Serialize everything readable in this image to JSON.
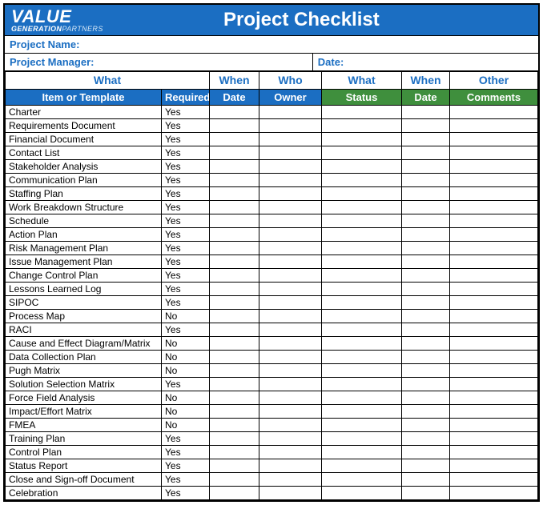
{
  "brand": {
    "name_top": "VALUE",
    "name_sub_bold": "GENERATION",
    "name_sub_light": "PARTNERS"
  },
  "title": "Project Checklist",
  "info": {
    "project_name_label": "Project Name:",
    "project_manager_label": "Project Manager:",
    "date_label": "Date:"
  },
  "group_headers": {
    "what": "What",
    "when": "When",
    "who": "Who",
    "what2": "What",
    "when2": "When",
    "other": "Other"
  },
  "col_headers": {
    "item": "Item or Template",
    "required": "Required",
    "date": "Date",
    "owner": "Owner",
    "status": "Status",
    "date2": "Date",
    "comments": "Comments"
  },
  "rows": [
    {
      "item": "Charter",
      "required": "Yes"
    },
    {
      "item": "Requirements Document",
      "required": "Yes"
    },
    {
      "item": "Financial Document",
      "required": "Yes"
    },
    {
      "item": "Contact List",
      "required": "Yes"
    },
    {
      "item": "Stakeholder Analysis",
      "required": "Yes"
    },
    {
      "item": "Communication Plan",
      "required": "Yes"
    },
    {
      "item": "Staffing Plan",
      "required": "Yes"
    },
    {
      "item": "Work Breakdown Structure",
      "required": "Yes"
    },
    {
      "item": "Schedule",
      "required": "Yes"
    },
    {
      "item": "Action Plan",
      "required": "Yes"
    },
    {
      "item": "Risk Management Plan",
      "required": "Yes"
    },
    {
      "item": "Issue Management Plan",
      "required": "Yes"
    },
    {
      "item": "Change Control Plan",
      "required": "Yes"
    },
    {
      "item": "Lessons Learned Log",
      "required": "Yes"
    },
    {
      "item": "SIPOC",
      "required": "Yes"
    },
    {
      "item": "Process Map",
      "required": "No"
    },
    {
      "item": "RACI",
      "required": "Yes"
    },
    {
      "item": "Cause and Effect Diagram/Matrix",
      "required": "No"
    },
    {
      "item": "Data Collection Plan",
      "required": "No"
    },
    {
      "item": "Pugh Matrix",
      "required": "No"
    },
    {
      "item": "Solution Selection Matrix",
      "required": "Yes"
    },
    {
      "item": "Force Field Analysis",
      "required": "No"
    },
    {
      "item": "Impact/Effort Matrix",
      "required": "No"
    },
    {
      "item": "FMEA",
      "required": "No"
    },
    {
      "item": "Training Plan",
      "required": "Yes"
    },
    {
      "item": "Control Plan",
      "required": "Yes"
    },
    {
      "item": "Status Report",
      "required": "Yes"
    },
    {
      "item": "Close and Sign-off Document",
      "required": "Yes"
    },
    {
      "item": "Celebration",
      "required": "Yes"
    }
  ]
}
